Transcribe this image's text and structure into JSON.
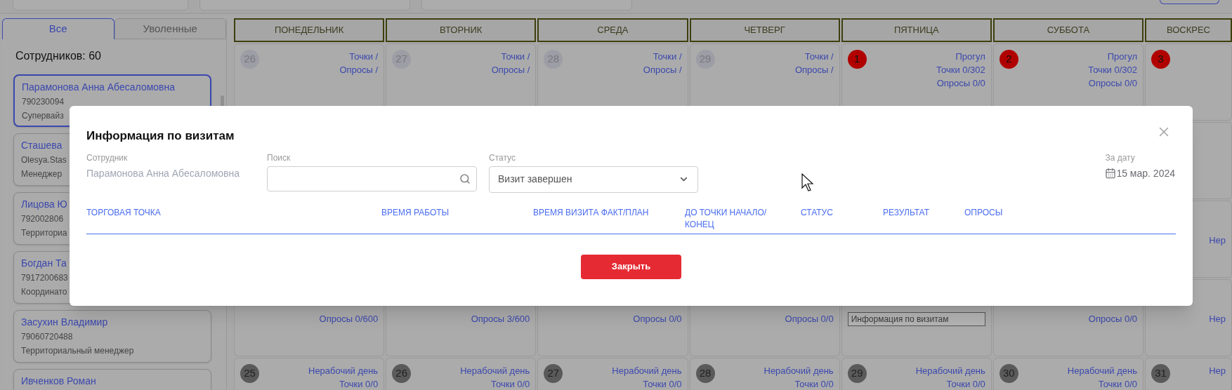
{
  "sidebar": {
    "tabs": [
      {
        "label": "Все",
        "selected": true
      },
      {
        "label": "Уволенные",
        "selected": false
      }
    ],
    "count": "Сотрудников: 60",
    "employees": [
      {
        "name": "Парамонова Анна Абесаломовна",
        "phone": "790230094",
        "role": "Супервайз",
        "selected": true
      },
      {
        "name": "Сташева",
        "phone": "Olesya.Stas",
        "role": "Менеджер",
        "selected": false
      },
      {
        "name": "Лицова Ю",
        "phone": "792002806",
        "role": "Территориа",
        "selected": false
      },
      {
        "name": "Богдан Та",
        "phone": "7917200683",
        "role": "Координато",
        "selected": false
      },
      {
        "name": "Засухин Владимир",
        "phone": "79060720488",
        "role": "Территориальный менеджер",
        "selected": false
      },
      {
        "name": "Ивченков Роман",
        "selected": false
      }
    ]
  },
  "calendar": {
    "weekdays": [
      "ПОНЕДЕЛЬНИК",
      "ВТОРНИК",
      "СРЕДА",
      "ЧЕТВЕРГ",
      "ПЯТНИЦА",
      "СУББОТА",
      "ВОСКРЕС"
    ],
    "weeks": [
      {
        "cells": [
          {
            "day": "26",
            "kind": "past",
            "lines": [
              "Точки /",
              "Опросы /"
            ]
          },
          {
            "day": "27",
            "kind": "past",
            "lines": [
              "Точки /",
              "Опросы /"
            ]
          },
          {
            "day": "28",
            "kind": "past",
            "lines": [
              "Точки /",
              "Опросы /"
            ]
          },
          {
            "day": "29",
            "kind": "past",
            "lines": [
              "Точки /",
              "Опросы /"
            ]
          },
          {
            "day": "1",
            "kind": "absent",
            "lines": [
              "Прогул",
              "Точки 0/302",
              "Опросы 0/0"
            ]
          },
          {
            "day": "2",
            "kind": "absent",
            "lines": [
              "Прогул",
              "Точки 0/302",
              "Опросы 0/0"
            ]
          },
          {
            "day": "3",
            "kind": "absent"
          }
        ]
      },
      {
        "cells": [
          {},
          {},
          {},
          {},
          {},
          {},
          {}
        ]
      },
      {
        "cells": [
          {},
          {},
          {},
          {},
          {},
          {},
          {
            "lines": [
              "Нер"
            ]
          }
        ]
      },
      {
        "cells": [
          {
            "lines": [
              "Опросы 0/600"
            ]
          },
          {
            "lines": [
              "Опросы 3/600"
            ]
          },
          {
            "lines": [
              "Опросы 0/0"
            ]
          },
          {
            "lines": [
              "Опросы 0/0"
            ]
          },
          {
            "tooltip": "Информация по визитам"
          },
          {
            "lines": [
              "Опросы 0/0"
            ]
          },
          {
            "lines": [
              "Нер"
            ]
          }
        ]
      },
      {
        "cells": [
          {
            "day": "25",
            "kind": "off",
            "lines": [
              "Нерабочий день",
              "Точки 0/0"
            ]
          },
          {
            "day": "26",
            "kind": "off",
            "lines": [
              "Нерабочий день",
              "Точки 0/0"
            ]
          },
          {
            "day": "27",
            "kind": "off",
            "lines": [
              "Нерабочий день",
              "Точки 0/0"
            ]
          },
          {
            "day": "28",
            "kind": "off",
            "lines": [
              "Нерабочий день",
              "Точки 0/0"
            ]
          },
          {
            "day": "29",
            "kind": "off",
            "lines": [
              "Нерабочий день",
              "Точки 0/0"
            ]
          },
          {
            "day": "30",
            "kind": "off",
            "lines": [
              "Нерабочий день",
              "Точки 0/0"
            ]
          },
          {
            "day": "31",
            "kind": "off",
            "lines": [
              "Нер"
            ]
          }
        ]
      }
    ]
  },
  "modal": {
    "title": "Информация по визитам",
    "employee": {
      "label": "Сотрудник",
      "value": "Парамонова Анна Абесаломовна"
    },
    "search": {
      "label": "Поиск"
    },
    "status": {
      "label": "Статус",
      "value": "Визит завершен"
    },
    "date": {
      "label": "За дату",
      "value": "15 мар. 2024"
    },
    "columns": [
      "ТОРГОВАЯ ТОЧКА",
      "ВРЕМЯ РАБОТЫ",
      "ВРЕМЯ ВИЗИТА ФАКТ/ПЛАН",
      "ДО ТОЧКИ НАЧАЛО/ КОНЕЦ",
      "СТАТУС",
      "РЕЗУЛЬТАТ",
      "ОПРОСЫ"
    ],
    "close_button": "Закрыть"
  }
}
